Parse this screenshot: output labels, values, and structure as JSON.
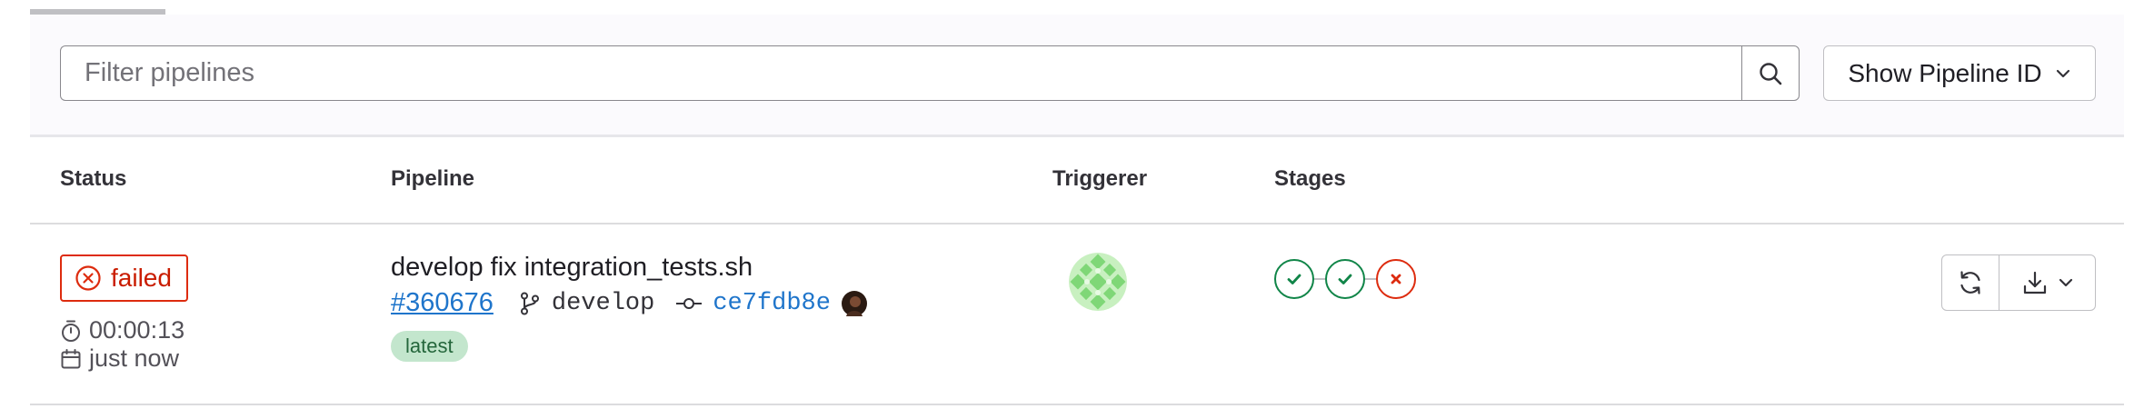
{
  "search": {
    "placeholder": "Filter pipelines"
  },
  "toolbar": {
    "show_pipeline_id_label": "Show Pipeline ID"
  },
  "table": {
    "headers": {
      "status": "Status",
      "pipeline": "Pipeline",
      "triggerer": "Triggerer",
      "stages": "Stages"
    },
    "rows": [
      {
        "status": "failed",
        "duration": "00:00:13",
        "finished": "just now",
        "title": "develop fix integration_tests.sh",
        "pipeline_id": "#360676",
        "branch": "develop",
        "commit_sha": "ce7fdb8e",
        "badge": "latest",
        "stages": [
          "success",
          "success",
          "failed"
        ]
      }
    ]
  },
  "colors": {
    "failed": "#dd2b0e",
    "success": "#108548",
    "link": "#1f75cb",
    "latest_bg": "#c3e6cd"
  }
}
